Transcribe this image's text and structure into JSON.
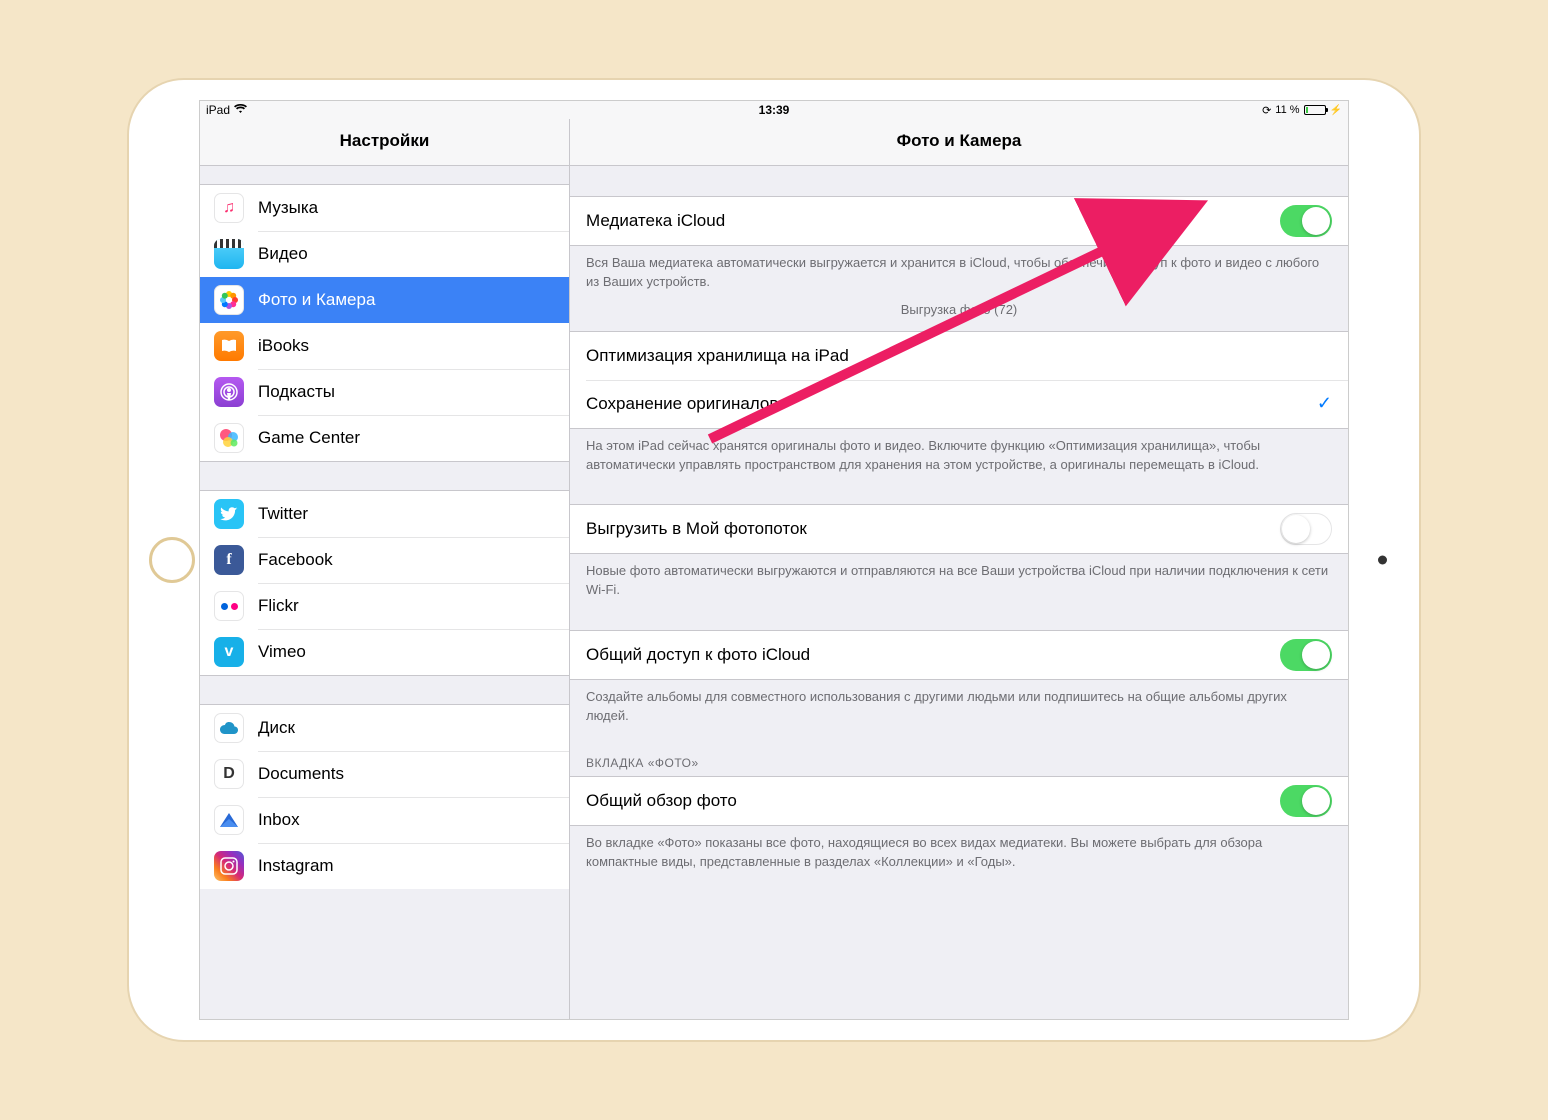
{
  "status": {
    "device": "iPad",
    "time": "13:39",
    "battery_percent": "11 %"
  },
  "sidebar": {
    "title": "Настройки",
    "groups": [
      [
        {
          "id": "music",
          "label": "Музыка"
        },
        {
          "id": "video",
          "label": "Видео"
        },
        {
          "id": "photo",
          "label": "Фото и Камера",
          "selected": true
        },
        {
          "id": "ibooks",
          "label": "iBooks"
        },
        {
          "id": "podcast",
          "label": "Подкасты"
        },
        {
          "id": "gamecenter",
          "label": "Game Center"
        }
      ],
      [
        {
          "id": "twitter",
          "label": "Twitter"
        },
        {
          "id": "facebook",
          "label": "Facebook"
        },
        {
          "id": "flickr",
          "label": "Flickr"
        },
        {
          "id": "vimeo",
          "label": "Vimeo"
        }
      ],
      [
        {
          "id": "disk",
          "label": "Диск"
        },
        {
          "id": "documents",
          "label": "Documents"
        },
        {
          "id": "inbox",
          "label": "Inbox"
        },
        {
          "id": "instagram",
          "label": "Instagram"
        }
      ]
    ]
  },
  "detail": {
    "title": "Фото и Камера",
    "icloud_library": {
      "label": "Медиатека iCloud",
      "on": true,
      "footer": "Вся Ваша медиатека автоматически выгружается и хранится в iCloud, чтобы обеспечить доступ к фото и видео с любого из Ваших устройств.",
      "upload_status": "Выгрузка фото (72)"
    },
    "storage_options": {
      "optimize": "Оптимизация хранилища на iPad",
      "keep_originals": "Сохранение оригиналов",
      "selected": "keep_originals",
      "footer": "На этом iPad сейчас хранятся оригиналы фото и видео. Включите функцию «Оптимизация хранилища», чтобы автоматически управлять пространством для хранения на этом устройстве, а оригиналы перемещать в iCloud."
    },
    "photostream": {
      "label": "Выгрузить в Мой фотопоток",
      "on": false,
      "footer": "Новые фото автоматически выгружаются и отправляются на все Ваши устройства iCloud при наличии подключения к сети Wi-Fi."
    },
    "shared": {
      "label": "Общий доступ к фото iCloud",
      "on": true,
      "footer": "Создайте альбомы для совместного использования с другими людьми или подпишитесь на общие альбомы других людей."
    },
    "photos_tab": {
      "header": "ВКЛАДКА «ФОТО»",
      "summarize": {
        "label": "Общий обзор фото",
        "on": true
      },
      "footer": "Во вкладке «Фото» показаны все фото, находящиеся во всех видах медиатеки. Вы можете выбрать для обзора компактные виды, представленные в разделах «Коллекции» и «Годы»."
    }
  }
}
